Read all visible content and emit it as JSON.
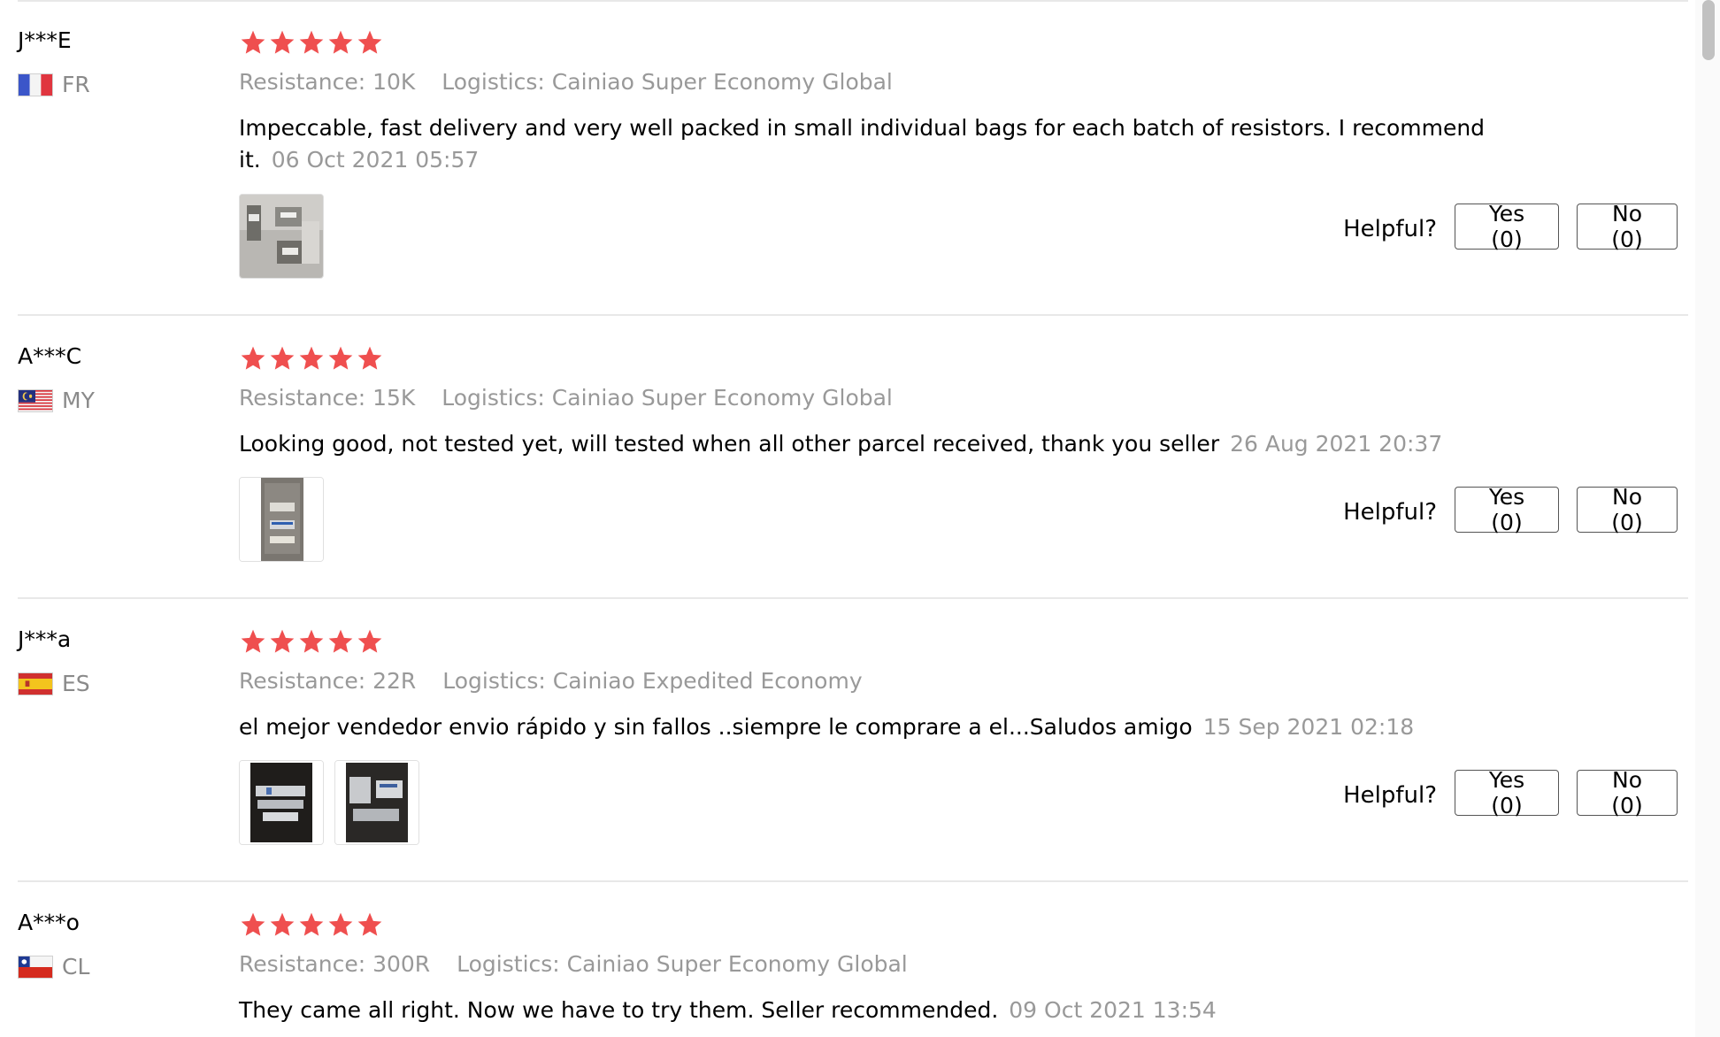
{
  "colors": {
    "star": "#ef4f4f",
    "muted_text": "#999999",
    "divider": "#e8e8e8"
  },
  "helpful_label": "Helpful?",
  "attr_labels": {
    "resistance": "Resistance:",
    "logistics": "Logistics:"
  },
  "reviews": [
    {
      "name": "J***E",
      "country": "FR",
      "flag_icon": "france-flag-icon",
      "rating": 5,
      "resistance": "10K",
      "logistics": "Cainiao Super Economy Global",
      "text": "Impeccable, fast delivery and very well packed in small individual bags for each batch of resistors. I recommend it.",
      "date": "06 Oct 2021 05:57",
      "photos": 1,
      "yes": "Yes (0)",
      "no": "No (0)"
    },
    {
      "name": "A***C",
      "country": "MY",
      "flag_icon": "malaysia-flag-icon",
      "rating": 5,
      "resistance": "15K",
      "logistics": "Cainiao Super Economy Global",
      "text": "Looking good, not tested yet, will tested when all other parcel received, thank you seller",
      "date": "26 Aug 2021 20:37",
      "photos": 1,
      "yes": "Yes (0)",
      "no": "No (0)"
    },
    {
      "name": "J***a",
      "country": "ES",
      "flag_icon": "spain-flag-icon",
      "rating": 5,
      "resistance": "22R",
      "logistics": "Cainiao Expedited Economy",
      "text": "el mejor vendedor envio rápido y sin fallos ..siempre le comprare a el...Saludos amigo",
      "date": "15 Sep 2021 02:18",
      "photos": 2,
      "yes": "Yes (0)",
      "no": "No (0)"
    },
    {
      "name": "A***o",
      "country": "CL",
      "flag_icon": "chile-flag-icon",
      "rating": 5,
      "resistance": "300R",
      "logistics": "Cainiao Super Economy Global",
      "text": "They came all right. Now we have to try them. Seller recommended.",
      "date": "09 Oct 2021 13:54"
    }
  ]
}
